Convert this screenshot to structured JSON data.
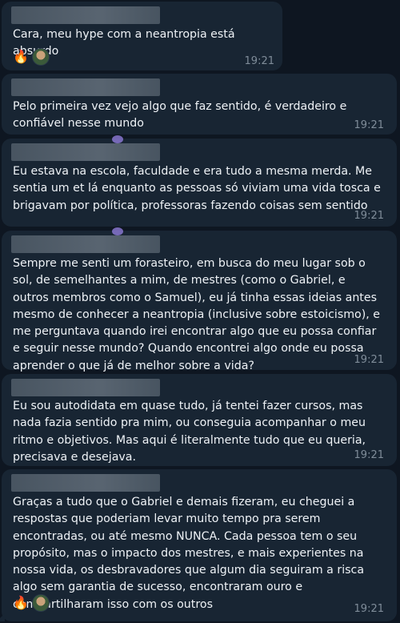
{
  "messages": [
    {
      "text": "Cara, meu hype com a neantropia está absurdo",
      "time": "19:21",
      "reactions": [
        "fire",
        "avatar"
      ]
    },
    {
      "text": "Pelo primeira vez vejo algo que faz sentido, é verdadeiro e confiável nesse mundo",
      "time": "19:21"
    },
    {
      "text": "Eu estava na escola, faculdade e era tudo a mesma merda. Me sentia um et lá enquanto as pessoas só viviam uma vida tosca e brigavam por política, professoras fazendo coisas sem sentido",
      "time": "19:21"
    },
    {
      "text": "Sempre me senti um forasteiro, em busca do meu lugar sob o sol, de semelhantes a mim, de mestres (como o Gabriel, e outros membros como o Samuel), eu já tinha essas ideias antes mesmo de conhecer a neantropia (inclusive sobre estoicismo), e me perguntava quando irei encontrar algo que eu possa confiar e seguir nesse mundo? Quando encontrei algo onde eu possa aprender o que já de melhor sobre a vida?",
      "time": "19:21"
    },
    {
      "text": "Eu sou autodidata em quase tudo, já tentei fazer cursos, mas nada fazia sentido pra mim, ou conseguia acompanhar o meu ritmo e objetivos. Mas aqui é literalmente tudo que eu queria, precisava e desejava.",
      "time": "19:21"
    },
    {
      "text": "Graças a tudo que o Gabriel e demais fizeram, eu cheguei a respostas que poderiam levar muito tempo pra serem encontradas, ou até mesmo NUNCA. Cada pessoa tem o seu propósito, mas o impacto dos mestres, e mais experientes na nossa vida, os desbravadores que algum dia seguiram a risca algo sem garantia de sucesso, encontraram ouro e compartilharam isso com os outros",
      "time": "19:21",
      "reactions": [
        "fire",
        "avatar"
      ]
    }
  ],
  "icons": {
    "fire": "🔥"
  }
}
